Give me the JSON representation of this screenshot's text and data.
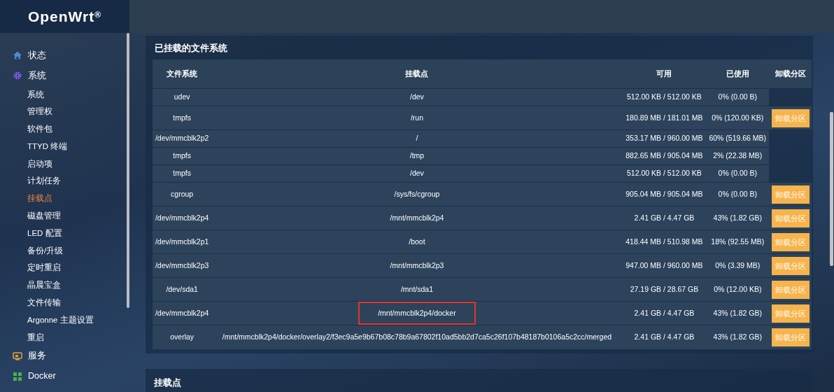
{
  "header": {
    "logo": "OpenWrt",
    "logo_mark": "®"
  },
  "sidebar": {
    "items": [
      {
        "label": "状态",
        "selected": false
      },
      {
        "label": "系统",
        "selected": false,
        "children": [
          {
            "label": "系统",
            "selected": false
          },
          {
            "label": "管理权",
            "selected": false
          },
          {
            "label": "软件包",
            "selected": false
          },
          {
            "label": "TTYD 终端",
            "selected": false
          },
          {
            "label": "启动项",
            "selected": false
          },
          {
            "label": "计划任务",
            "selected": false
          },
          {
            "label": "挂载点",
            "selected": true
          },
          {
            "label": "磁盘管理",
            "selected": false
          },
          {
            "label": "LED 配置",
            "selected": false
          },
          {
            "label": "备份/升级",
            "selected": false
          },
          {
            "label": "定时重启",
            "selected": false
          },
          {
            "label": "晶晨宝盒",
            "selected": false
          },
          {
            "label": "文件传输",
            "selected": false
          },
          {
            "label": "Argonne 主题设置",
            "selected": false
          },
          {
            "label": "重启",
            "selected": false
          }
        ]
      },
      {
        "label": "服务",
        "selected": false
      },
      {
        "label": "Docker",
        "selected": false
      }
    ]
  },
  "mounted_section": {
    "title": "已挂载的文件系统",
    "table": {
      "columns": [
        "文件系统",
        "挂载点",
        "可用",
        "已使用",
        "卸载分区"
      ],
      "rows": [
        {
          "filesystem": "udev",
          "mount_point": "/dev",
          "available": "512.00 KB / 512.00 KB",
          "used": "0% (0.00 B)",
          "highlighted": false
        },
        {
          "filesystem": "tmpfs",
          "mount_point": "/run",
          "available": "180.89 MB / 181.01 MB",
          "used": "0% (120.00 KB)",
          "button": "卸载分区",
          "highlighted": false
        },
        {
          "filesystem": "/dev/mmcblk2p2",
          "mount_point": "/",
          "available": "353.17 MB / 960.00 MB",
          "used": "60% (519.66 MB)",
          "highlighted": false
        },
        {
          "filesystem": "tmpfs",
          "mount_point": "/tmp",
          "available": "882.65 MB / 905.04 MB",
          "used": "2% (22.38 MB)",
          "highlighted": false
        },
        {
          "filesystem": "tmpfs",
          "mount_point": "/dev",
          "available": "512.00 KB / 512.00 KB",
          "used": "0% (0.00 B)",
          "highlighted": false
        },
        {
          "filesystem": "cgroup",
          "mount_point": "/sys/fs/cgroup",
          "available": "905.04 MB / 905.04 MB",
          "used": "0% (0.00 B)",
          "button": "卸载分区",
          "highlighted": false
        },
        {
          "filesystem": "/dev/mmcblk2p4",
          "mount_point": "/mnt/mmcblk2p4",
          "available": "2.41 GB / 4.47 GB",
          "used": "43% (1.82 GB)",
          "button": "卸载分区",
          "highlighted": false
        },
        {
          "filesystem": "/dev/mmcblk2p1",
          "mount_point": "/boot",
          "available": "418.44 MB / 510.98 MB",
          "used": "18% (92.55 MB)",
          "button": "卸载分区",
          "highlighted": false
        },
        {
          "filesystem": "/dev/mmcblk2p3",
          "mount_point": "/mnt/mmcblk2p3",
          "available": "947.00 MB / 960.00 MB",
          "used": "0% (3.39 MB)",
          "button": "卸载分区",
          "highlighted": false
        },
        {
          "filesystem": "/dev/sda1",
          "mount_point": "/mnt/sda1",
          "available": "27.19 GB / 28.67 GB",
          "used": "0% (12.00 KB)",
          "button": "卸载分区",
          "highlighted": false
        },
        {
          "filesystem": "/dev/mmcblk2p4",
          "mount_point": "/mnt/mmcblk2p4/docker",
          "available": "2.41 GB / 4.47 GB",
          "used": "43% (1.82 GB)",
          "button": "卸载分区",
          "highlighted": true
        },
        {
          "filesystem": "overlay",
          "mount_point": "/mnt/mmcblk2p4/docker/overlay2/f3ec9a5e9b67b08c78b9a67802f10ad5bb2d7ca5c26f107b48187b0106a5c2cc/merged",
          "available": "2.41 GB / 4.47 GB",
          "used": "43% (1.82 GB)",
          "button": "卸载分区",
          "highlighted": false
        }
      ]
    }
  },
  "mount_points_section": {
    "title": "挂载点"
  }
}
